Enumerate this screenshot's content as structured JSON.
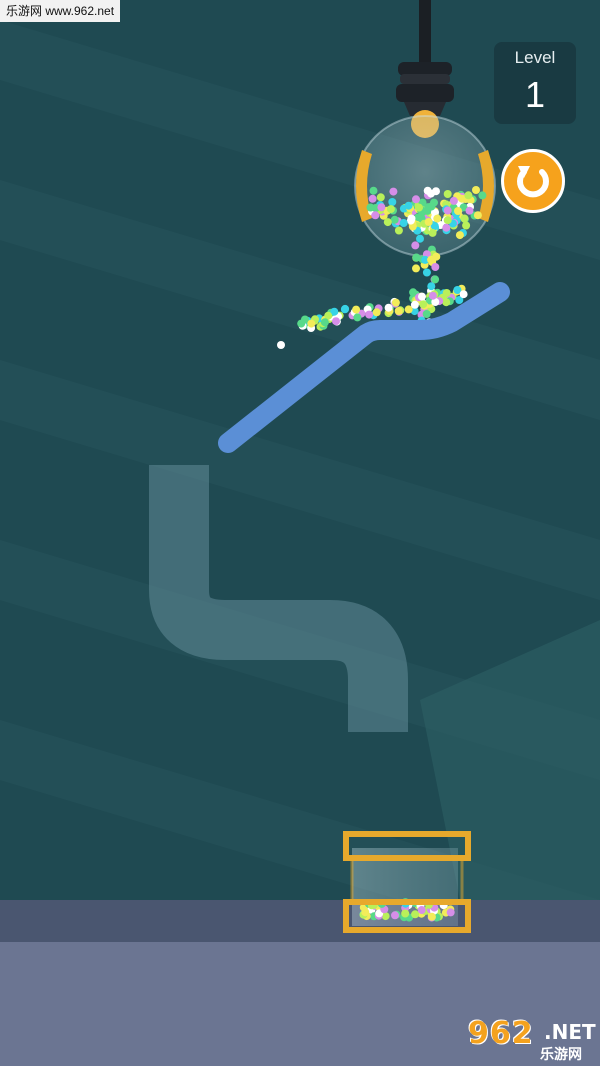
{
  "watermark": {
    "site_text": "乐游网 www.962.net",
    "logo_number": "962",
    "logo_suffix": ".NET",
    "logo_cn": "乐游网"
  },
  "hud": {
    "level_label": "Level",
    "level_value": "1",
    "restart_icon": "restart-icon"
  },
  "colors": {
    "background": "#1f4a52",
    "stripe": "#245058",
    "ramp": "#5b8fd6",
    "pipe": "#6f9aa6",
    "floor_top": "#4a5670",
    "floor": "#6b7592",
    "gold": "#e7a92c",
    "button": "#f6a21c",
    "balls": [
      "#f2ec5a",
      "#57d98a",
      "#37d3e6",
      "#d68ee8",
      "#b9f05a",
      "#ffffff"
    ]
  }
}
